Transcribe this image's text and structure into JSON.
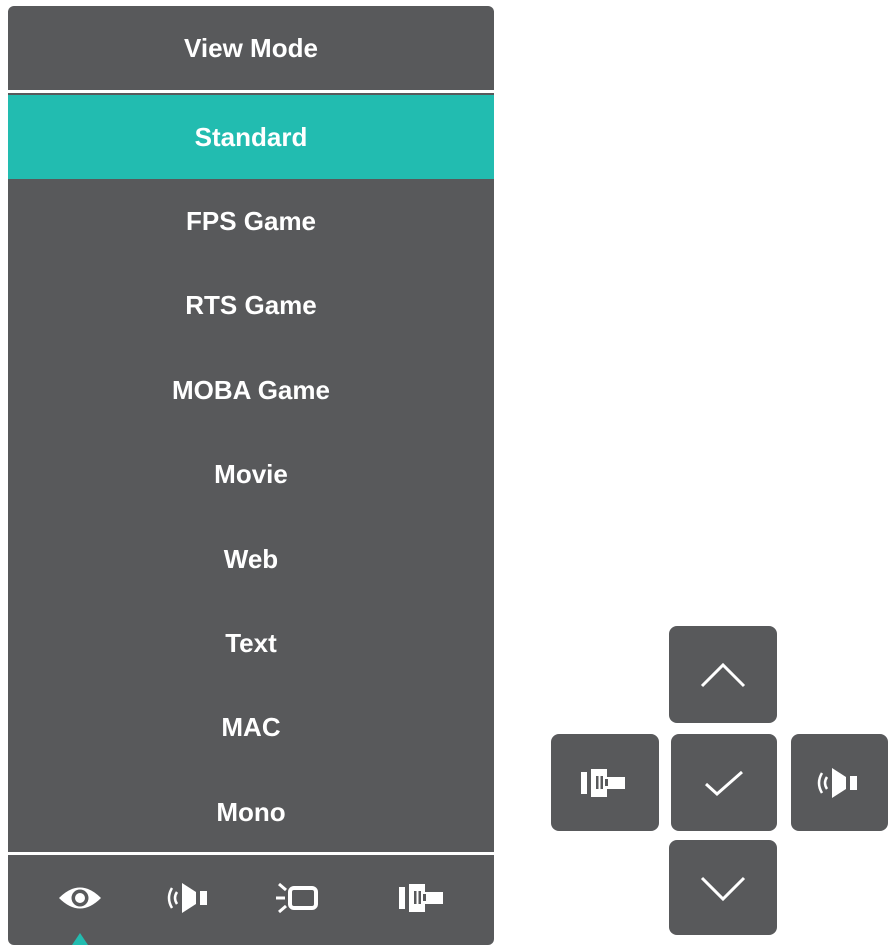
{
  "osd": {
    "title": "View Mode",
    "selected_index": 0,
    "items": [
      {
        "label": "Standard"
      },
      {
        "label": "FPS Game"
      },
      {
        "label": "RTS Game"
      },
      {
        "label": "MOBA Game"
      },
      {
        "label": "Movie"
      },
      {
        "label": "Web"
      },
      {
        "label": "Text"
      },
      {
        "label": "MAC"
      },
      {
        "label": "Mono"
      }
    ],
    "bottom_icons": [
      "eye-icon",
      "audio-icon",
      "display-icon",
      "input-source-icon"
    ],
    "active_bottom_icon": "eye-icon"
  },
  "keypad": {
    "buttons": [
      "up-arrow-icon",
      "input-source-icon",
      "check-icon",
      "audio-icon",
      "down-arrow-icon"
    ]
  },
  "colors": {
    "panel": "#58595b",
    "accent": "#22bcb0",
    "text": "#ffffff"
  }
}
